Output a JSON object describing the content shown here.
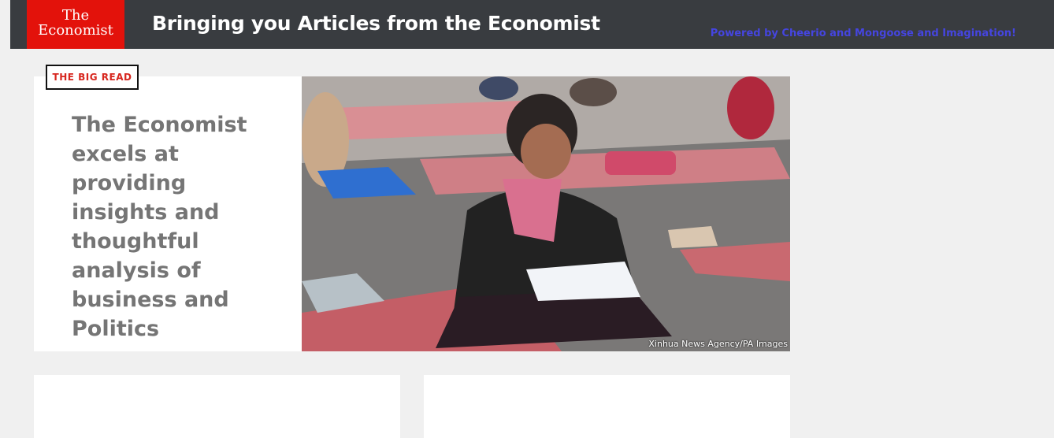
{
  "header": {
    "logo_line1": "The",
    "logo_line2": "Economist",
    "headline": "Bringing you Articles from the Economist",
    "powered_by": "Powered by Cheerio and Mongoose and Imagination!"
  },
  "feature": {
    "badge": "THE BIG READ",
    "title": "The Economist excels at providing insights and thoughtful analysis of business and Politics",
    "image_credit": "Xinhua News Agency/PA Images"
  },
  "colors": {
    "navbar": "#393c40",
    "brand_red": "#e3120b",
    "powered_blue": "#4545e0",
    "title_gray": "#757575"
  }
}
